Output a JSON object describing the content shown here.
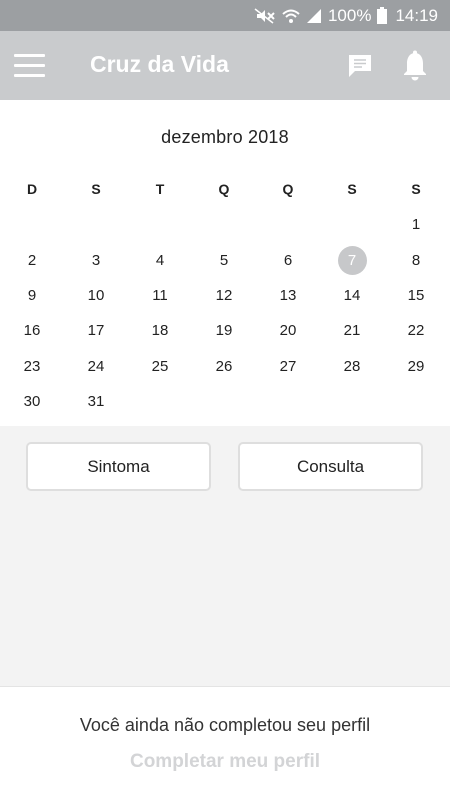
{
  "status_bar": {
    "battery": "100%",
    "time": "14:19",
    "icons": [
      "mute-icon",
      "wifi-icon",
      "signal-icon",
      "battery-icon"
    ]
  },
  "app_bar": {
    "title": "Cruz da Vida",
    "icons": [
      "menu-icon",
      "chat-icon",
      "bell-icon"
    ]
  },
  "calendar": {
    "month_title": "dezembro 2018",
    "weekdays": [
      "D",
      "S",
      "T",
      "Q",
      "Q",
      "S",
      "S"
    ],
    "weeks": [
      [
        "",
        "",
        "",
        "",
        "",
        "",
        "1"
      ],
      [
        "2",
        "3",
        "4",
        "5",
        "6",
        "7",
        "8"
      ],
      [
        "9",
        "10",
        "11",
        "12",
        "13",
        "14",
        "15"
      ],
      [
        "16",
        "17",
        "18",
        "19",
        "20",
        "21",
        "22"
      ],
      [
        "23",
        "24",
        "25",
        "26",
        "27",
        "28",
        "29"
      ],
      [
        "30",
        "31",
        "",
        "",
        "",
        "",
        ""
      ]
    ],
    "selected_day": "7",
    "selected_color": "#c7c8ca"
  },
  "actions": {
    "symptom_label": "Sintoma",
    "consult_label": "Consulta"
  },
  "footer": {
    "message": "Você ainda não completou seu perfil",
    "link_label": "Completar meu perfil"
  },
  "colors": {
    "status_bar": "#9c9fa2",
    "app_bar": "#c9cbcd",
    "background": "#f3f3f3",
    "link": "#d3d4d6"
  }
}
